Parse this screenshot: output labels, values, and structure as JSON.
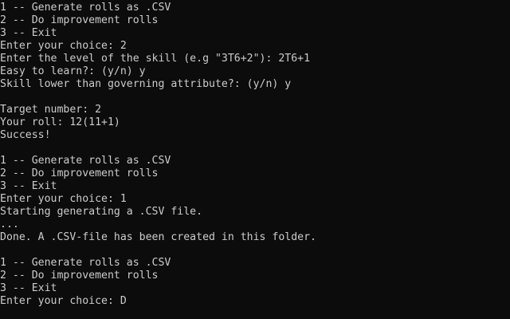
{
  "theme": {
    "background": "#0c0c0c",
    "foreground": "#cccccc"
  },
  "console": {
    "lines": [
      "1 -- Generate rolls as .CSV",
      "2 -- Do improvement rolls",
      "3 -- Exit",
      "Enter your choice: 2",
      "Enter the level of the skill (e.g \"3T6+2\"): 2T6+1",
      "Easy to learn?: (y/n) y",
      "Skill lower than governing attribute?: (y/n) y",
      "",
      "Target number: 2",
      "Your roll: 12(11+1)",
      "Success!",
      "",
      "1 -- Generate rolls as .CSV",
      "2 -- Do improvement rolls",
      "3 -- Exit",
      "Enter your choice: 1",
      "Starting generating a .CSV file.",
      "...",
      "Done. A .CSV-file has been created in this folder.",
      "",
      "1 -- Generate rolls as .CSV",
      "2 -- Do improvement rolls",
      "3 -- Exit",
      "Enter your choice: D"
    ]
  }
}
